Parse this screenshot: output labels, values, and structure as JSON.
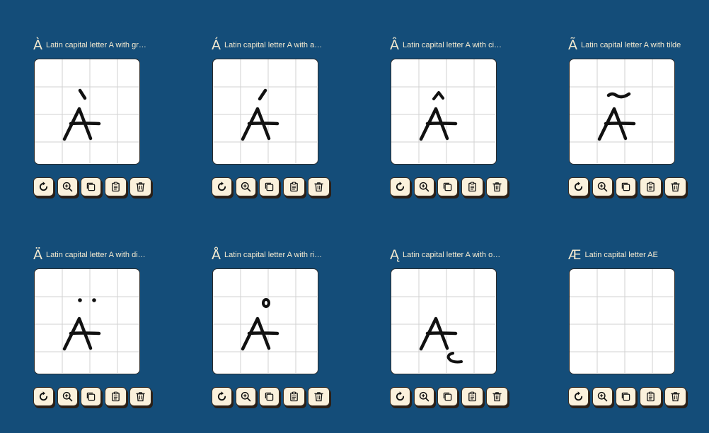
{
  "cells": [
    {
      "glyph": "À",
      "name": "Latin capital letter A with gr…",
      "mark": "grave"
    },
    {
      "glyph": "Á",
      "name": "Latin capital letter A with a…",
      "mark": "acute"
    },
    {
      "glyph": "Â",
      "name": "Latin capital letter A with ci…",
      "mark": "circumflex"
    },
    {
      "glyph": "Ã",
      "name": "Latin capital letter A with tilde",
      "mark": "tilde"
    },
    {
      "glyph": "Ä",
      "name": "Latin capital letter A with di…",
      "mark": "diaeresis"
    },
    {
      "glyph": "Å",
      "name": "Latin capital letter A with ri…",
      "mark": "ring"
    },
    {
      "glyph": "Ą",
      "name": "Latin capital letter A with o…",
      "mark": "ogonek"
    },
    {
      "glyph": "Æ",
      "name": "Latin capital letter AE",
      "mark": "none"
    }
  ],
  "toolbar": [
    "reset-icon",
    "zoom-in-icon",
    "copy-icon",
    "paste-icon",
    "trash-icon"
  ],
  "colors": {
    "background": "#144d79",
    "label": "#f4ead0",
    "button": "#fbf1dc",
    "ink": "#111111",
    "grid": "#d2d2d2"
  }
}
